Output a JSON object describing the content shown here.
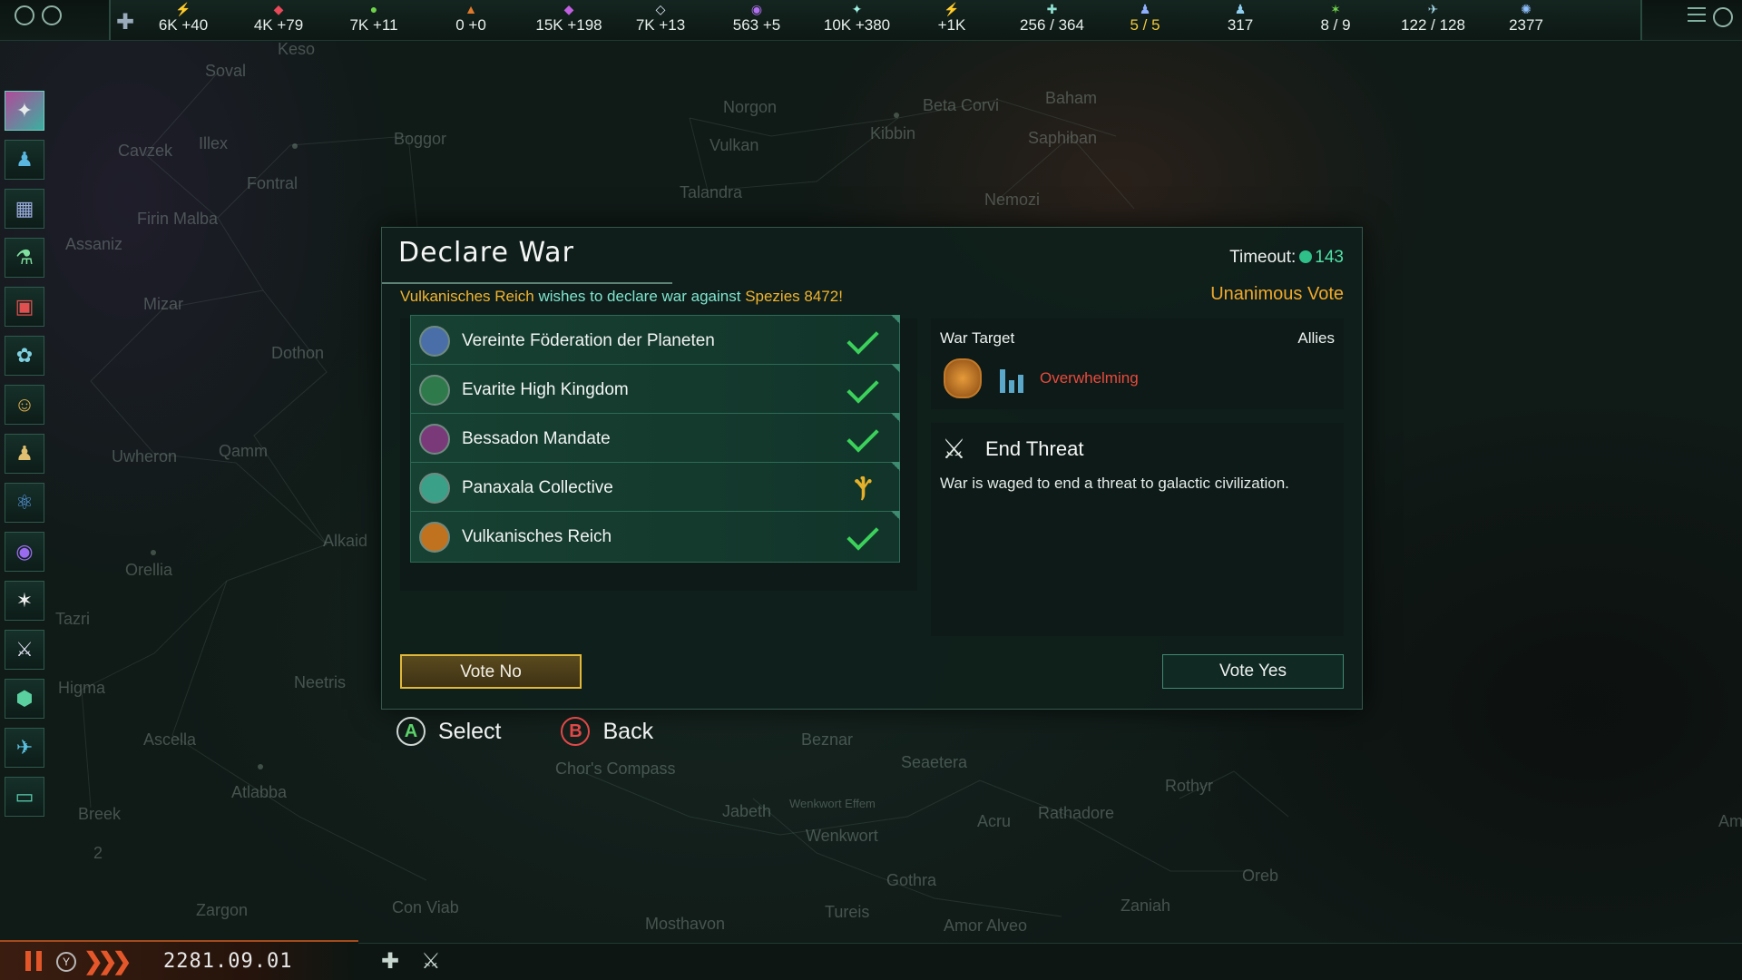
{
  "resources": [
    {
      "icon": "energy-icon",
      "symbol": "⚡",
      "value": "6K +40",
      "color": "#f2d23b"
    },
    {
      "icon": "minerals-icon",
      "symbol": "◆",
      "value": "4K +79",
      "color": "#e84a5a"
    },
    {
      "icon": "food-icon",
      "symbol": "●",
      "value": "7K +11",
      "color": "#6ed34a"
    },
    {
      "icon": "consumer-goods-icon",
      "symbol": "▲",
      "value": "0 +0",
      "color": "#e07a2a"
    },
    {
      "icon": "alloys-icon",
      "symbol": "◆",
      "value": "15K +198",
      "color": "#c060e0"
    },
    {
      "icon": "influence-icon",
      "symbol": "◇",
      "value": "7K +13",
      "color": "#e8f0ff"
    },
    {
      "icon": "unity-icon",
      "symbol": "◉",
      "value": "563 +5",
      "color": "#b070f0"
    },
    {
      "icon": "research-icon",
      "symbol": "✦",
      "value": "10K +380",
      "color": "#9ef0e0"
    },
    {
      "icon": "sprawl-icon",
      "symbol": "⚡",
      "value": "+1K",
      "color": "#e0c060"
    },
    {
      "icon": "empire-size-icon",
      "symbol": "✚",
      "value": "256 / 364",
      "color": "#8fe0d0"
    },
    {
      "icon": "envoys-icon",
      "symbol": "♟",
      "value": "5 / 5",
      "color": "#8fb0ff",
      "highlight": true
    },
    {
      "icon": "population-icon",
      "symbol": "♟",
      "value": "317",
      "color": "#8fd0f0"
    },
    {
      "icon": "systems-icon",
      "symbol": "✶",
      "value": "8 / 9",
      "color": "#6ed34a"
    },
    {
      "icon": "naval-capacity-icon",
      "symbol": "✈",
      "value": "122 / 128",
      "color": "#9fd0e0"
    },
    {
      "icon": "fleet-power-icon",
      "symbol": "✺",
      "value": "2377",
      "color": "#8fc0ff"
    }
  ],
  "map_labels": [
    "Keso",
    "Soval",
    "Cavzek",
    "Illex",
    "Boggor",
    "Fontral",
    "Firin Malba",
    "Assaniz",
    "Mizar",
    "Dothon",
    "Uwheron",
    "Qamm",
    "Alkaid",
    "Orellia",
    "Tazri",
    "Higma",
    "Neetris",
    "Ascella",
    "Atlabba",
    "Breek",
    "Zargon",
    "Con Viab",
    "Mosthavon",
    "Tureis",
    "Amor Alveo",
    "Gothra",
    "Zaniah",
    "Oreb",
    "Wenkwort",
    "Jabeth",
    "Acru",
    "Rathadore",
    "Rothyr",
    "Seaetera",
    "Beznar",
    "Chor's Compass",
    "Norgon",
    "Vulkan",
    "Talandra",
    "Kibbin",
    "Beta Corvi",
    "Baham",
    "Saphiban",
    "Nemozi",
    "2",
    "Am",
    "Wenkwort Effem"
  ],
  "dialog": {
    "title": "Declare War",
    "timeout_label": "Timeout:",
    "timeout_value": "143",
    "subtitle_actor": "Vulkanisches Reich",
    "subtitle_text": " wishes to declare war against ",
    "subtitle_target": "Spezies 8472",
    "subtitle_end": "!",
    "vote_type": "Unanimous Vote",
    "voters": [
      {
        "name": "Vereinte Föderation der Planeten",
        "vote": "yes",
        "color": "#4a6fa8"
      },
      {
        "name": "Evarite High Kingdom",
        "vote": "yes",
        "color": "#2f7a4a"
      },
      {
        "name": "Bessadon Mandate",
        "vote": "yes",
        "color": "#7a3a7a"
      },
      {
        "name": "Panaxala Collective",
        "vote": "abstain",
        "color": "#3aa088"
      },
      {
        "name": "Vulkanisches Reich",
        "vote": "yes",
        "color": "#c0721f"
      }
    ],
    "war_target_label": "War Target",
    "allies_label": "Allies",
    "strength": "Overwhelming",
    "claim_title": "End Threat",
    "claim_desc": "War is waged to end a threat to galactic civilization.",
    "vote_no": "Vote No",
    "vote_yes": "Vote Yes"
  },
  "hints": {
    "select": "Select",
    "back": "Back",
    "a": "A",
    "b": "B",
    "y": "Y"
  },
  "date": "2281.09.01",
  "speed_symbol": "❯❯❯"
}
